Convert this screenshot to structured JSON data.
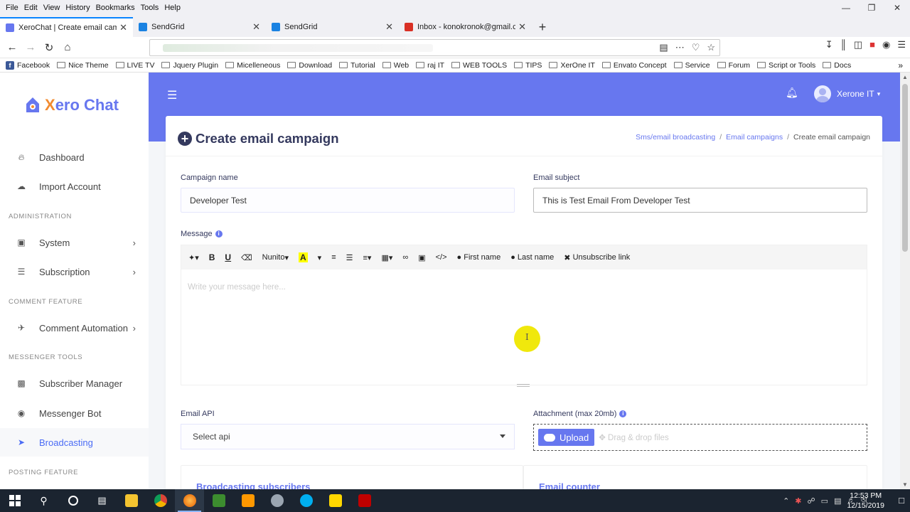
{
  "browser": {
    "menu": [
      "File",
      "Edit",
      "View",
      "History",
      "Bookmarks",
      "Tools",
      "Help"
    ],
    "tabs": [
      {
        "title": "XeroChat | Create email campa",
        "active": true,
        "color": "#6777ef"
      },
      {
        "title": "SendGrid",
        "active": false,
        "color": "#1a82e2"
      },
      {
        "title": "SendGrid",
        "active": false,
        "color": "#1a82e2"
      },
      {
        "title": "Inbox - konokronok@gmail.co",
        "active": false,
        "color": "#d93025"
      }
    ],
    "bookmarks": [
      "Facebook",
      "Nice Theme",
      "LIVE TV",
      "Jquery Plugin",
      "Micelleneous",
      "Download",
      "Tutorial",
      "Web",
      "raj IT",
      "WEB TOOLS",
      "TIPS",
      "XerOne IT",
      "Envato Concept",
      "Service",
      "Forum",
      "Script or Tools",
      "Docs"
    ]
  },
  "sidebar": {
    "logo": {
      "prefix": "X",
      "rest": "ero Chat"
    },
    "items": [
      {
        "label": "Dashboard",
        "icon": "fire-icon",
        "chevron": false
      },
      {
        "label": "Import Account",
        "icon": "cloud-download-icon",
        "chevron": false
      },
      {
        "label": "System",
        "icon": "laptop-icon",
        "chevron": true
      },
      {
        "label": "Subscription",
        "icon": "coins-icon",
        "chevron": true
      },
      {
        "label": "Comment Automation",
        "icon": "comments-icon",
        "chevron": true
      },
      {
        "label": "Subscriber Manager",
        "icon": "user-card-icon",
        "chevron": false
      },
      {
        "label": "Messenger Bot",
        "icon": "robot-icon",
        "chevron": false
      },
      {
        "label": "Broadcasting",
        "icon": "paper-plane-icon",
        "chevron": false,
        "active": true
      }
    ],
    "headings": [
      "ADMINISTRATION",
      "COMMENT FEATURE",
      "MESSENGER TOOLS",
      "POSTING FEATURE"
    ]
  },
  "header": {
    "user": "Xerone IT"
  },
  "page": {
    "title": "Create email campaign",
    "breadcrumb": [
      "Sms/email broadcasting",
      "Email campaigns",
      "Create email campaign"
    ],
    "campaign_name_label": "Campaign name",
    "campaign_name_value": "Developer Test",
    "email_subject_label": "Email subject",
    "email_subject_value": "This is Test Email From Developer Test",
    "message_label": "Message",
    "editor": {
      "font": "Nunito",
      "first_name": "First name",
      "last_name": "Last name",
      "unsubscribe": "Unsubscribe link",
      "placeholder": "Write your message here..."
    },
    "email_api_label": "Email API",
    "email_api_value": "Select api",
    "attachment_label": "Attachment (max 20mb)",
    "upload_label": "Upload",
    "drag_text": "Drag & drop files",
    "broadcasting_subscribers": "Broadcasting subscribers",
    "email_counter": "Email counter"
  },
  "taskbar": {
    "time": "12:53 PM",
    "date": "12/15/2019"
  },
  "colors": {
    "accent": "#6777ef",
    "title": "#34395e"
  }
}
